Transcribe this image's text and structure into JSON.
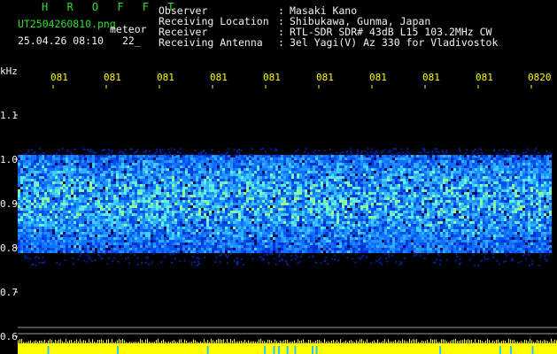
{
  "header": {
    "app_title": "H R O F F T",
    "filename": "UT2504260810.png",
    "tag": "meteor",
    "datetime": "25.04.26 08:10",
    "counter": "22_",
    "fields": [
      {
        "label": "Observer",
        "value": "Masaki Kano"
      },
      {
        "label": "Receiving Location",
        "value": "Shibukawa, Gunma, Japan"
      },
      {
        "label": "Receiver",
        "value": "RTL-SDR SDR# 43dB L15 103.2MHz CW"
      },
      {
        "label": "Receiving Antenna",
        "value": "3el Yagi(V) Az 330 for Vladivostok"
      }
    ]
  },
  "chart": {
    "yunit": "kHz",
    "ytick_labels": [
      "1.1",
      "1.0",
      "0.9",
      "0.8",
      "0.7",
      "0.6"
    ],
    "xtick_labels": [
      "081",
      "081",
      "081",
      "081",
      "081",
      "081",
      "081",
      "081",
      "081",
      "0820"
    ],
    "noise_band_khz": [
      0.79,
      1.01
    ]
  }
}
